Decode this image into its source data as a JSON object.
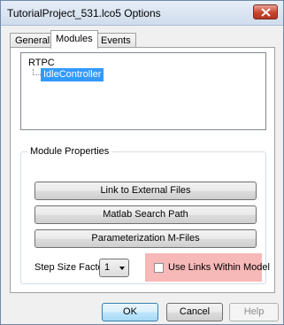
{
  "window": {
    "title": "TutorialProject_531.lco5 Options"
  },
  "tabs": [
    {
      "label": "General"
    },
    {
      "label": "Modules"
    },
    {
      "label": "Events"
    }
  ],
  "active_tab": "Modules",
  "tree": {
    "root": "RTPC",
    "children": [
      {
        "label": "IdleController",
        "selected": true
      }
    ]
  },
  "module_properties": {
    "group_label": "Module Properties",
    "buttons": [
      {
        "label": "Link to External Files"
      },
      {
        "label": "Matlab Search Path"
      },
      {
        "label": "Parameterization M-Files"
      }
    ],
    "step_size_label": "Step Size Factor",
    "step_size_value": "1",
    "use_links_label": "Use Links Within Model",
    "use_links_checked": false
  },
  "footer": {
    "ok": "OK",
    "cancel": "Cancel",
    "help": "Help"
  },
  "colors": {
    "selection": "#3399ff",
    "highlight": "#f7b8b8",
    "close_button": "#c8452f"
  },
  "icons": {
    "close": "close-icon"
  }
}
